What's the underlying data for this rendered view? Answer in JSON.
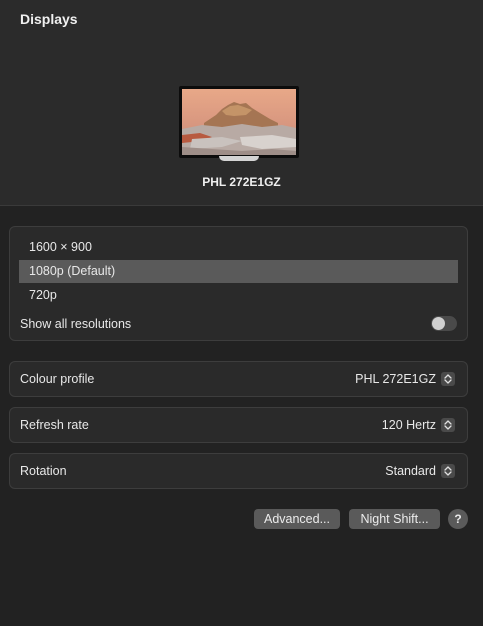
{
  "window": {
    "title": "Displays"
  },
  "display": {
    "name": "PHL 272E1GZ",
    "thumbnail_icon": "monitor-wallpaper-icon"
  },
  "resolutions": {
    "options": [
      "1600 × 900",
      "1080p (Default)",
      "720p"
    ],
    "selected": "1080p (Default)",
    "show_all_label": "Show all resolutions",
    "show_all_enabled": false
  },
  "settings": {
    "colour_profile": {
      "label": "Colour profile",
      "value": "PHL 272E1GZ"
    },
    "refresh_rate": {
      "label": "Refresh rate",
      "value": "120 Hertz"
    },
    "rotation": {
      "label": "Rotation",
      "value": "Standard"
    }
  },
  "buttons": {
    "advanced": "Advanced...",
    "night_shift": "Night Shift...",
    "help": "?"
  },
  "colors": {
    "background": "#222222",
    "header": "#2b2b2b",
    "card": "#2a2a2a",
    "selected_row": "#5a5a5a",
    "button": "#5a5a5a"
  }
}
